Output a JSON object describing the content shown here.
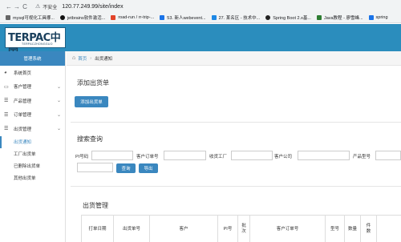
{
  "browser": {
    "nav": {
      "back": "←",
      "forward": "→",
      "reload": "C"
    },
    "security_label": "不安全",
    "url": "120.77.249.99/site/index",
    "bookmarks": [
      {
        "label": "mysql可视化工具哪...",
        "color": "#666666"
      },
      {
        "label": "jetbrains软件激活...",
        "color": "#111111"
      },
      {
        "label": "road-run / rr-trip-...",
        "color": "#e24329"
      },
      {
        "label": "53. 新人webevent...",
        "color": "#1a73e8"
      },
      {
        "label": "27. 某名区 - 技术中...",
        "color": "#1e88e5"
      },
      {
        "label": "Spring Boot 2.x基...",
        "color": "#222222"
      },
      {
        "label": "Java教程 - 廖雪峰...",
        "color": "#2e7d32"
      },
      {
        "label": "spring",
        "color": "#1a73e8"
      }
    ]
  },
  "header": {
    "logo_text": "TERPAC中国",
    "logo_sub": "TERPACZHONGGUO"
  },
  "sidebar": {
    "title": "管理系统",
    "items": [
      {
        "label": "系统首页",
        "icon": "dashboard-icon"
      },
      {
        "label": "客户管理",
        "icon": "monitor-icon"
      },
      {
        "label": "产品管理",
        "icon": "list-icon"
      },
      {
        "label": "订单管理",
        "icon": "list-icon"
      },
      {
        "label": "出货管理",
        "icon": "list-icon"
      }
    ],
    "sub_items": [
      "出货通知",
      "工厂出货单",
      "已删除出货单",
      "其他出货单"
    ]
  },
  "breadcrumb": {
    "home": "首页",
    "current": "出货通知"
  },
  "add_section": {
    "title": "添加出货单",
    "button": "添加出货单"
  },
  "search": {
    "title": "搜索查询",
    "fields": [
      {
        "label": "PI号码"
      },
      {
        "label": "客户订单号"
      },
      {
        "label": "收货工厂"
      },
      {
        "label": "客户公司"
      },
      {
        "label": "产品型号"
      }
    ],
    "query_button": "查询",
    "export_button": "导出"
  },
  "table": {
    "title": "出货管理",
    "columns": [
      "打单日期",
      "出货单号",
      "客户",
      "PI号",
      "批次",
      "客户订单号",
      "型号",
      "数量",
      "件数"
    ]
  }
}
